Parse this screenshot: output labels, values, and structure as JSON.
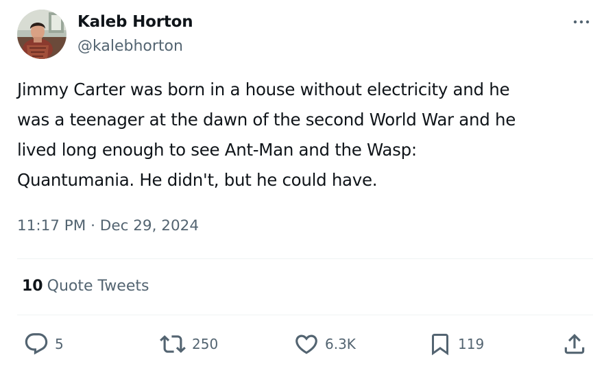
{
  "author": {
    "display_name": "Kaleb Horton",
    "handle": "@kalebhorton",
    "avatar_icon": "user-avatar-photo"
  },
  "more_icon": "more-dots-icon",
  "tweet": {
    "lines": [
      "Jimmy Carter was born in a house without electricity and he",
      "was a teenager at the dawn of the second World War and he",
      "lived long enough to see Ant-Man and the Wasp:",
      "Quantumania. He didn't, but he could have."
    ],
    "timestamp": "11:17 PM · Dec 29, 2024"
  },
  "quotes": {
    "count": "10",
    "label": "Quote Tweets"
  },
  "actions": {
    "reply": {
      "icon": "reply-icon",
      "count": "5"
    },
    "retweet": {
      "icon": "retweet-icon",
      "count": "250"
    },
    "like": {
      "icon": "heart-icon",
      "count": "6.3K"
    },
    "bookmark": {
      "icon": "bookmark-icon",
      "count": "119"
    },
    "share": {
      "icon": "share-icon"
    }
  },
  "colors": {
    "text": "#0f1419",
    "secondary": "#536471",
    "divider": "#eff3f4"
  }
}
